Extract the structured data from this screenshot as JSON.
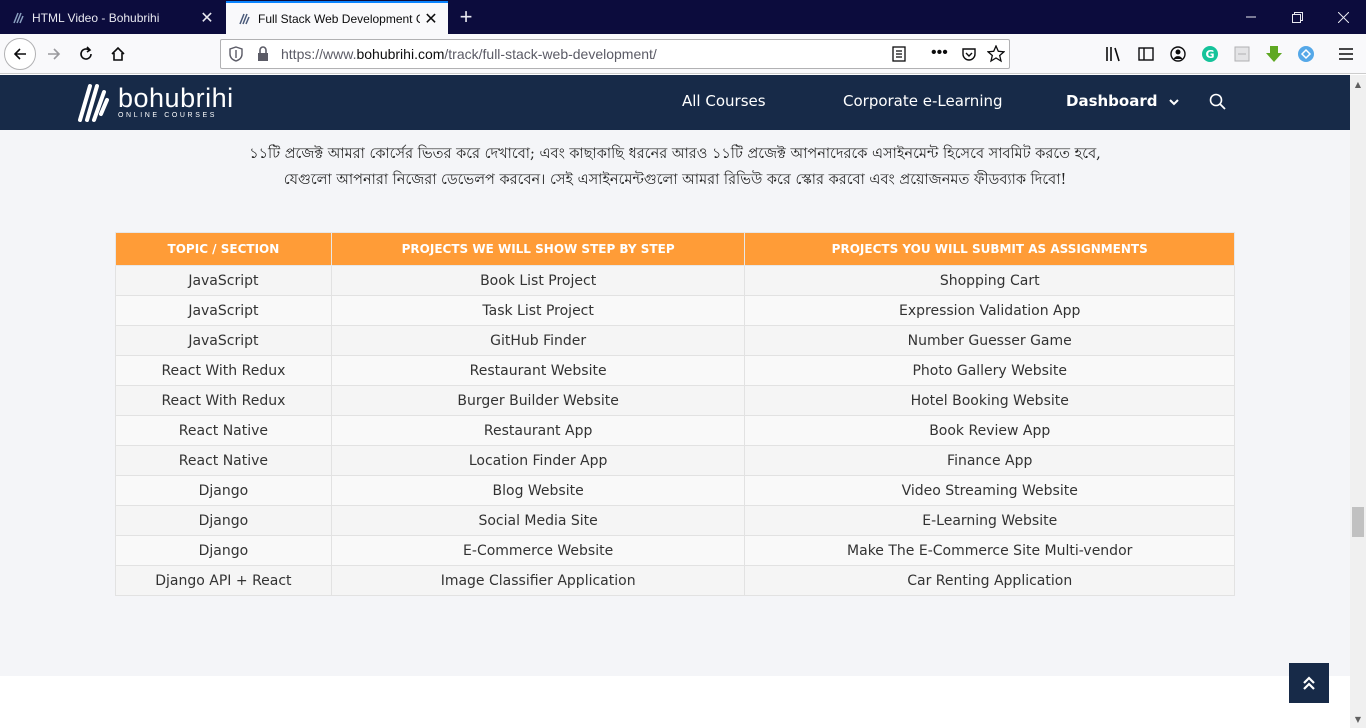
{
  "browser": {
    "tabs": [
      {
        "title": "HTML Video - Bohubrihi",
        "active": false
      },
      {
        "title": "Full Stack Web Development Course",
        "active": true
      }
    ],
    "url_prefix": "https://www.",
    "url_domain": "bohubrihi.com",
    "url_path": "/track/full-stack-web-development/"
  },
  "site": {
    "logo_name": "bohubrihi",
    "logo_sub": "ONLINE COURSES",
    "nav": {
      "all_courses": "All Courses",
      "corporate": "Corporate e-Learning",
      "dashboard": "Dashboard"
    }
  },
  "intro": {
    "line1": "১১টি প্রজেক্ট আমরা কোর্সের ভিতর করে দেখাবো; এবং কাছাকাছি ধরনের আরও ১১টি প্রজেক্ট আপনাদেরকে এসাইনমেন্ট হিসেবে সাবমিট করতে হবে,",
    "line2": "যেগুলো আপনারা নিজেরা ডেভেলপ করবেন। সেই এসাইনমেন্টগুলো আমরা রিভিউ করে স্কোর করবো এবং প্রয়োজনমত ফীডব্যাক দিবো!"
  },
  "table": {
    "headers": [
      "TOPIC / SECTION",
      "PROJECTS WE WILL SHOW STEP BY STEP",
      "PROJECTS YOU WILL SUBMIT AS ASSIGNMENTS"
    ],
    "rows": [
      [
        "JavaScript",
        "Book List Project",
        "Shopping Cart"
      ],
      [
        "JavaScript",
        "Task List Project",
        "Expression Validation App"
      ],
      [
        "JavaScript",
        "GitHub Finder",
        "Number Guesser Game"
      ],
      [
        "React With Redux",
        "Restaurant Website",
        "Photo Gallery Website"
      ],
      [
        "React With Redux",
        "Burger Builder Website",
        "Hotel Booking Website"
      ],
      [
        "React Native",
        "Restaurant App",
        "Book Review App"
      ],
      [
        "React Native",
        "Location Finder App",
        "Finance App"
      ],
      [
        "Django",
        "Blog Website",
        "Video Streaming Website"
      ],
      [
        "Django",
        "Social Media Site",
        "E-Learning Website"
      ],
      [
        "Django",
        "E-Commerce Website",
        "Make The E-Commerce Site Multi-vendor"
      ],
      [
        "Django API + React",
        "Image Classifier Application",
        "Car Renting Application"
      ]
    ]
  },
  "colors": {
    "header_bg": "#172a48",
    "table_header": "#ff9c37",
    "tabstrip": "#0c0c3d"
  }
}
